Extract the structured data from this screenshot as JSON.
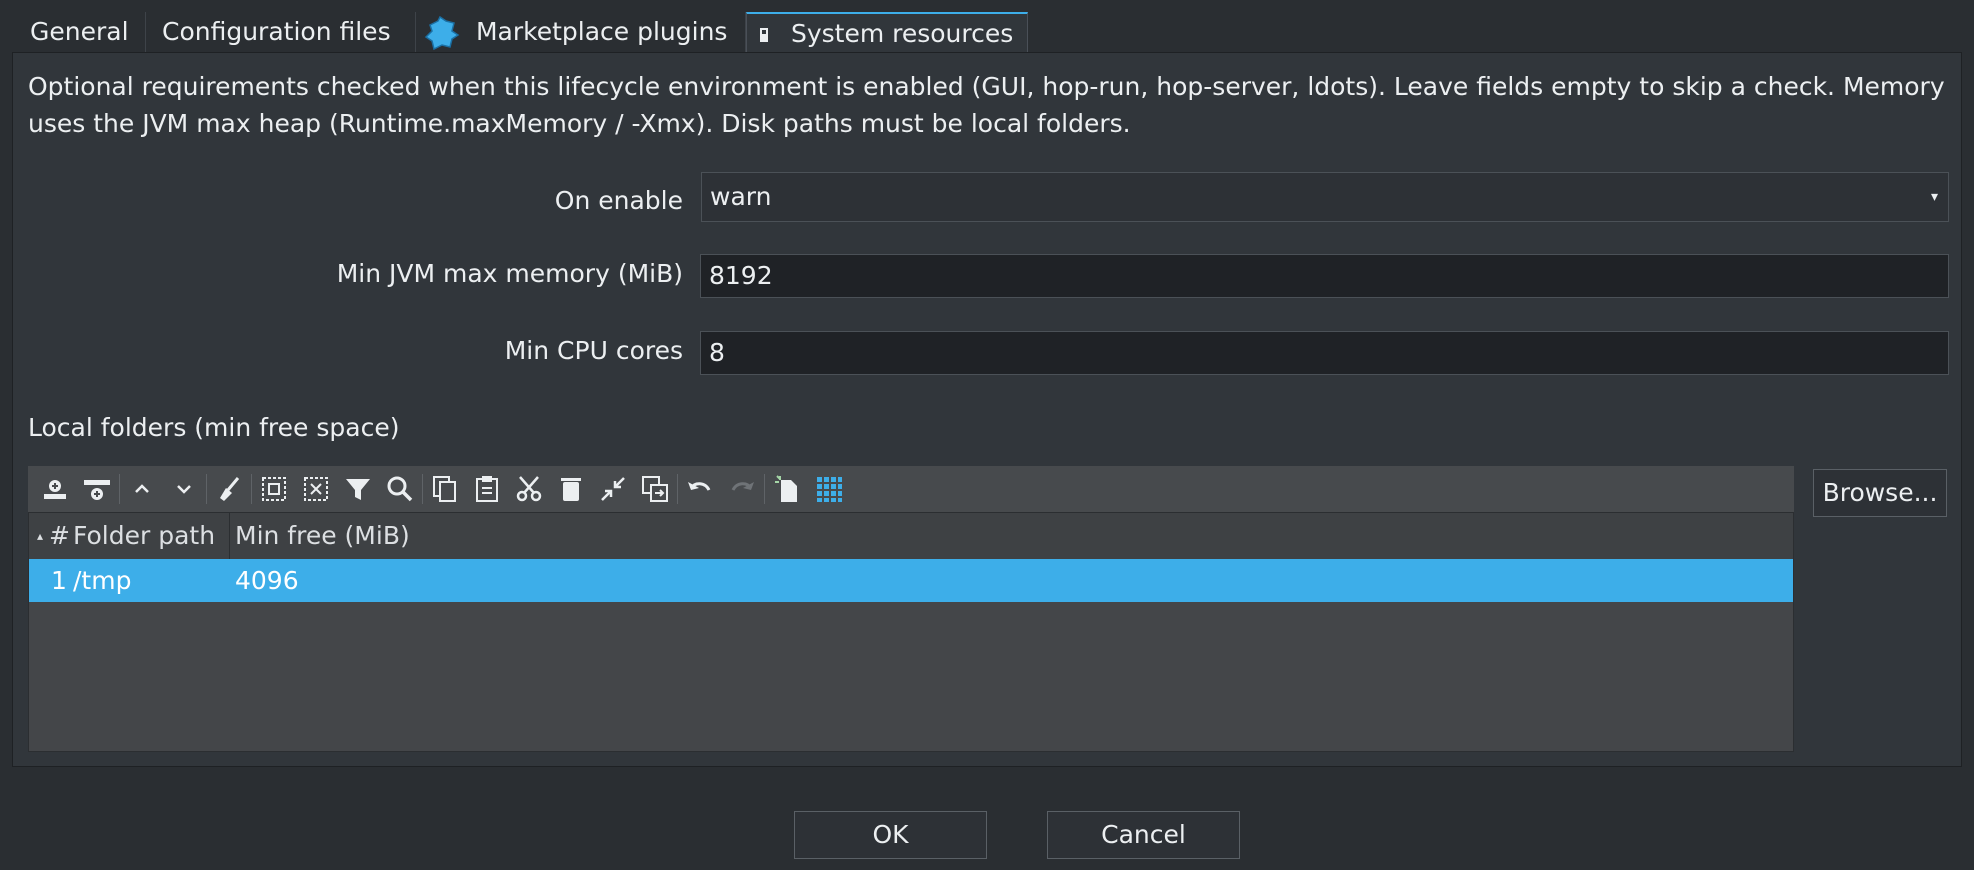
{
  "tabs": [
    {
      "label": "General"
    },
    {
      "label": "Configuration files"
    },
    {
      "label": "Marketplace plugins"
    },
    {
      "label": "System resources"
    }
  ],
  "description": "Optional requirements checked when this lifecycle environment is enabled (GUI, hop-run, hop-server, ldots). Leave fields empty to skip a check. Memory uses the JVM max heap (Runtime.maxMemory / -Xmx). Disk paths must be local folders.",
  "form": {
    "on_enable_label": "On enable",
    "on_enable_value": "warn",
    "memory_label": "Min JVM max memory (MiB)",
    "memory_value": "8192",
    "cpu_label": "Min CPU cores",
    "cpu_value": "8"
  },
  "folders": {
    "title": "Local folders (min free space)",
    "columns": [
      "#",
      "Folder path",
      "Min free (MiB)"
    ],
    "rows": [
      {
        "index": "1",
        "path": "/tmp",
        "min_free": "4096"
      }
    ],
    "browse_label": "Browse..."
  },
  "toolbar_icons": [
    "insert-row-icon",
    "add-row-icon",
    "move-up-icon",
    "move-down-icon",
    "clean-icon",
    "select-all-icon",
    "clear-selection-icon",
    "filter-icon",
    "search-icon",
    "copy-icon",
    "paste-icon",
    "cut-icon",
    "delete-icon",
    "collapse-icon",
    "duplicate-icon",
    "undo-icon",
    "redo-icon",
    "new-file-icon",
    "grid-icon"
  ],
  "buttons": {
    "ok": "OK",
    "cancel": "Cancel"
  },
  "colors": {
    "accent": "#3daee9",
    "background": "#2a2e32",
    "panel": "#31363b"
  }
}
